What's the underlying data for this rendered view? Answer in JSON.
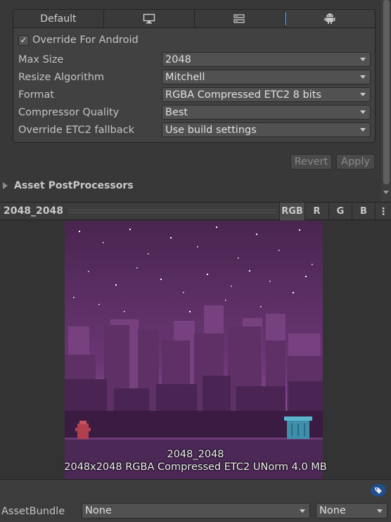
{
  "platform_tabs": [
    {
      "label": "Default",
      "icon": ""
    },
    {
      "label": "",
      "icon": "monitor-icon"
    },
    {
      "label": "",
      "icon": "server-icon"
    },
    {
      "label": "",
      "icon": "android-icon"
    }
  ],
  "override": {
    "label": "Override For Android",
    "checked": true,
    "check_glyph": "✓"
  },
  "settings": [
    {
      "label": "Max Size",
      "value": "2048"
    },
    {
      "label": "Resize Algorithm",
      "value": "Mitchell"
    },
    {
      "label": "Format",
      "value": "RGBA Compressed ETC2 8 bits"
    },
    {
      "label": "Compressor Quality",
      "value": "Best"
    },
    {
      "label": "Override ETC2 fallback",
      "value": "Use build settings"
    }
  ],
  "buttons": {
    "revert": "Revert",
    "apply": "Apply"
  },
  "section": {
    "title": "Asset PostProcessors"
  },
  "preview": {
    "title": "2048_2048",
    "channels": [
      "RGB",
      "R",
      "G",
      "B"
    ],
    "more": "⋮",
    "image_name": "2048_2048",
    "image_info": "2048x2048  RGBA Compressed ETC2 UNorm   4.0 MB"
  },
  "assetbundle": {
    "label": "AssetBundle",
    "name": "None",
    "variant": "None"
  },
  "colors": {
    "accent": "#3a79bb",
    "sky_top": "#4a2550",
    "sky_bottom": "#9a5aa8"
  }
}
